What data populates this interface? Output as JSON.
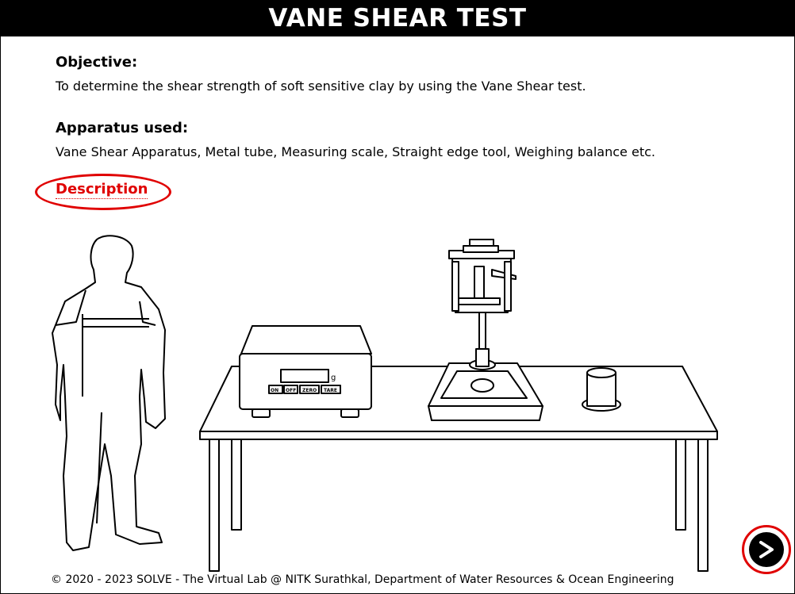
{
  "header": {
    "title": "VANE SHEAR TEST"
  },
  "objective": {
    "heading": "Objective:",
    "text": "To determine the shear strength of soft sensitive clay by using the Vane Shear test."
  },
  "apparatus": {
    "heading": "Apparatus used:",
    "text": "Vane Shear Apparatus, Metal tube, Measuring scale, Straight edge tool, Weighing balance etc."
  },
  "description_link": "Description",
  "balance": {
    "unit": "g",
    "buttons": [
      "ON",
      "OFF",
      "ZERO",
      "TARE"
    ]
  },
  "footer": "© 2020 - 2023 SOLVE - The Virtual Lab @ NITK Surathkal, Department of Water Resources & Ocean Engineering",
  "colors": {
    "accent": "#e00000",
    "titlebar": "#000000"
  },
  "icons": {
    "next": "arrow-right-circle-icon"
  }
}
